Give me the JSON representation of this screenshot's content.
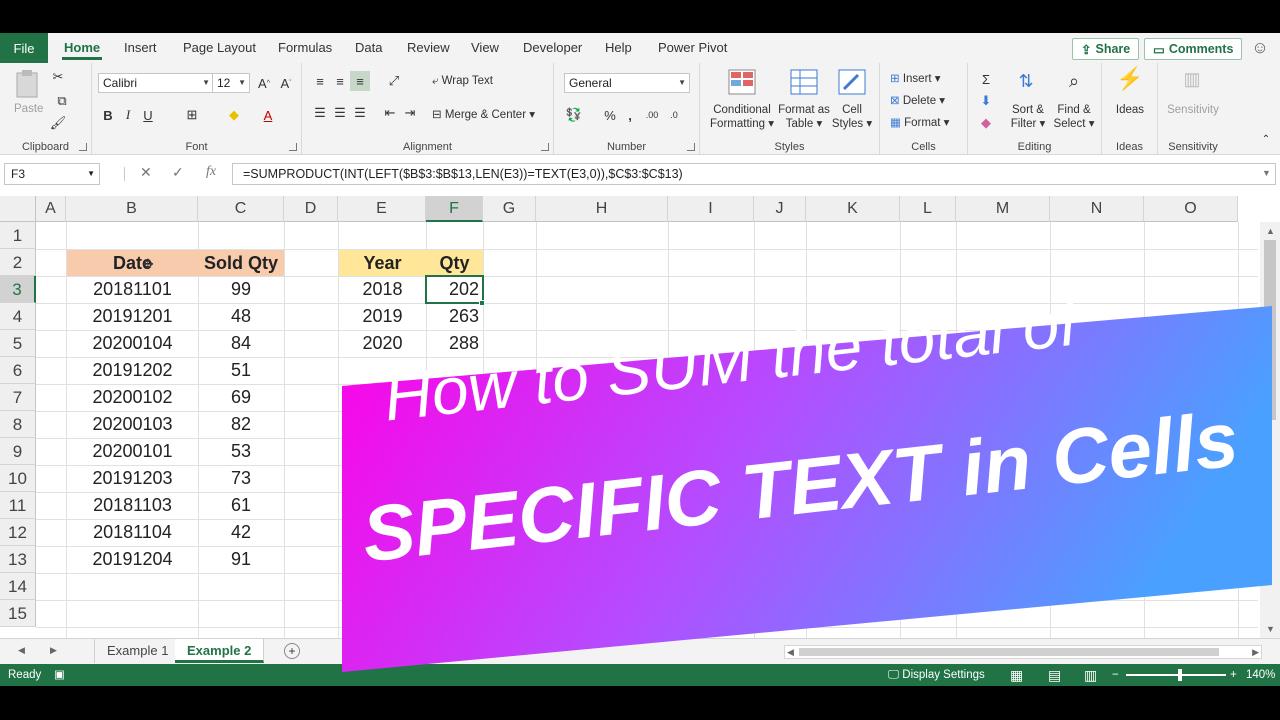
{
  "ribbon_tabs": {
    "file": "File",
    "tabs": [
      "Home",
      "Insert",
      "Page Layout",
      "Formulas",
      "Data",
      "Review",
      "View",
      "Developer",
      "Help",
      "Power Pivot"
    ],
    "share": "Share",
    "comments": "Comments"
  },
  "ribbon": {
    "clipboard": {
      "paste": "Paste",
      "label": "Clipboard"
    },
    "font": {
      "name": "Calibri",
      "size": "12",
      "bold": "B",
      "italic": "I",
      "underline": "U",
      "label": "Font"
    },
    "alignment": {
      "wrap_text": "Wrap Text",
      "merge_center": "Merge & Center",
      "label": "Alignment"
    },
    "number": {
      "format": "General",
      "label": "Number"
    },
    "styles": {
      "conditional_1": "Conditional",
      "conditional_2": "Formatting",
      "format_as_1": "Format as",
      "format_as_2": "Table",
      "cell_styles_1": "Cell",
      "cell_styles_2": "Styles",
      "label": "Styles"
    },
    "cells": {
      "insert": "Insert",
      "delete": "Delete",
      "format": "Format",
      "label": "Cells"
    },
    "editing": {
      "sort_1": "Sort &",
      "sort_2": "Filter",
      "find_1": "Find &",
      "find_2": "Select",
      "label": "Editing"
    },
    "ideas": {
      "btn": "Ideas",
      "label": "Ideas"
    },
    "sensitivity": {
      "btn": "Sensitivity",
      "label": "Sensitivity"
    }
  },
  "formula_bar": {
    "name_box": "F3",
    "formula": "=SUMPRODUCT(INT(LEFT($B$3:$B$13,LEN(E3))=TEXT(E3,0)),$C$3:$C$13)"
  },
  "columns": [
    "A",
    "B",
    "C",
    "D",
    "E",
    "F",
    "G",
    "H",
    "I",
    "J",
    "K",
    "L",
    "M",
    "N",
    "O"
  ],
  "rows": [
    "1",
    "2",
    "3",
    "4",
    "5",
    "6",
    "7",
    "8",
    "9",
    "10",
    "11",
    "12",
    "13",
    "14",
    "15"
  ],
  "table1": {
    "headers": [
      "Date",
      "Sold Qty"
    ],
    "rows": [
      [
        "20181101",
        "99"
      ],
      [
        "20191201",
        "48"
      ],
      [
        "20200104",
        "84"
      ],
      [
        "20191202",
        "51"
      ],
      [
        "20200102",
        "69"
      ],
      [
        "20200103",
        "82"
      ],
      [
        "20200101",
        "53"
      ],
      [
        "20191203",
        "73"
      ],
      [
        "20181103",
        "61"
      ],
      [
        "20181104",
        "42"
      ],
      [
        "20191204",
        "91"
      ]
    ]
  },
  "table2": {
    "headers": [
      "Year",
      "Qty"
    ],
    "rows": [
      [
        "2018",
        "202"
      ],
      [
        "2019",
        "263"
      ],
      [
        "2020",
        "288"
      ]
    ]
  },
  "sheets": [
    "Example 1",
    "Example 2"
  ],
  "status": {
    "ready": "Ready",
    "display_settings": "Display Settings",
    "zoom": "140%"
  },
  "banner": {
    "line1": "How to SUM the total of",
    "line2": "SPECIFIC TEXT in Cells"
  },
  "colors": {
    "excel_green": "#217346",
    "header_orange": "#f8cbad",
    "header_yellow": "#ffe699",
    "banner_start": "#ff00e6",
    "banner_end": "#4aa0ff"
  }
}
